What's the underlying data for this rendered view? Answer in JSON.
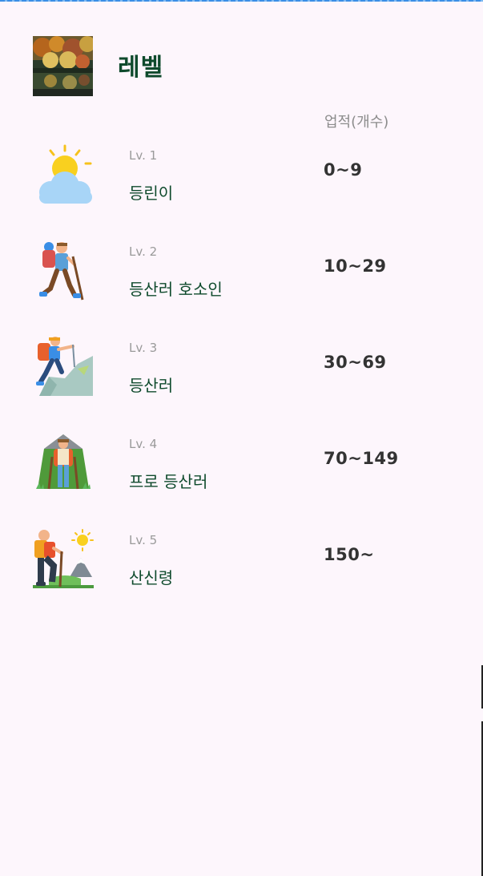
{
  "header": {
    "title": "레벨",
    "thumbnail": "autumn-lake-photo"
  },
  "table": {
    "count_header": "업적(개수)"
  },
  "levels": [
    {
      "tag": "Lv. 1",
      "name": "등린이",
      "range": "0~9",
      "icon": "sun-cloud-icon"
    },
    {
      "tag": "Lv. 2",
      "name": "등산러 호소인",
      "range": "10~29",
      "icon": "hiker-walking-icon"
    },
    {
      "tag": "Lv. 3",
      "name": "등산러",
      "range": "30~69",
      "icon": "climber-icon"
    },
    {
      "tag": "Lv. 4",
      "name": "프로 등산러",
      "range": "70~149",
      "icon": "pro-hiker-icon"
    },
    {
      "tag": "Lv. 5",
      "name": "산신령",
      "range": "150~",
      "icon": "summit-hiker-icon"
    }
  ],
  "colors": {
    "background": "#fdf6fc",
    "title": "#0e4a2c",
    "range": "#333333",
    "muted": "#9a9a9a"
  }
}
